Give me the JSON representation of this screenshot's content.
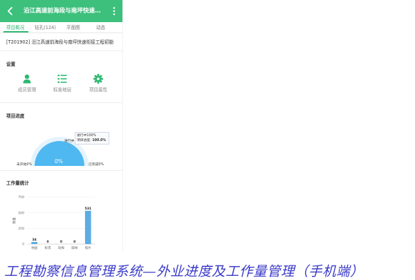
{
  "header": {
    "title": "沿江高速前海段与南坪快速衔接工…"
  },
  "tabs": [
    {
      "label": "项目概况"
    },
    {
      "label": "钻孔(124)"
    },
    {
      "label": "平面图"
    },
    {
      "label": "动态"
    }
  ],
  "project": {
    "name": "[T201902] 沿江高速前海段与南坪快速衔接工程初勘"
  },
  "settings": {
    "title": "设置",
    "items": [
      {
        "label": "成员管理",
        "icon": "person-icon"
      },
      {
        "label": "标准地层",
        "icon": "list-icon"
      },
      {
        "label": "项目属性",
        "icon": "gear-icon"
      }
    ]
  },
  "progress": {
    "title": "项目进度",
    "center_label": "0%",
    "not_started": "未开始0%",
    "in_progress": "进行中",
    "completed": "已完成0%",
    "tooltip_line1": "进行中100%",
    "tooltip_line2_prefix": "项目进度: ",
    "tooltip_line2_value": "100.0%"
  },
  "workload": {
    "title": "工作量统计",
    "ylabel": "数量"
  },
  "chart_data": {
    "type": "bar",
    "title": "工作量统计",
    "ylabel": "数量",
    "categories": [
      "地层",
      "标贯",
      "动探",
      "取样",
      "照片"
    ],
    "values": [
      34,
      0,
      0,
      0,
      531
    ],
    "ylim": [
      0,
      750
    ],
    "yticks": [
      0,
      250,
      500,
      750
    ],
    "grid": true
  },
  "caption": "工程勘察信息管理系统—外业进度及工作量管理（手机端）",
  "colors": {
    "brand": "#3cc07c",
    "accent": "#2eb872",
    "bar": "#5dade2",
    "gauge": "#4fb8f0"
  }
}
